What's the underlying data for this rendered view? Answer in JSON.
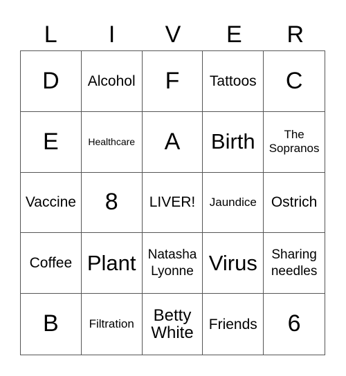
{
  "header": [
    "L",
    "I",
    "V",
    "E",
    "R"
  ],
  "cells": [
    {
      "text": "D",
      "size": "s-xl"
    },
    {
      "text": "Alcohol",
      "size": "s-m"
    },
    {
      "text": "F",
      "size": "s-xl"
    },
    {
      "text": "Tattoos",
      "size": "s-m"
    },
    {
      "text": "C",
      "size": "s-xl"
    },
    {
      "text": "E",
      "size": "s-xl"
    },
    {
      "text": "Healthcare",
      "size": "s-xxs"
    },
    {
      "text": "A",
      "size": "s-xl"
    },
    {
      "text": "Birth",
      "size": "s-l"
    },
    {
      "text": "The Sopranos",
      "size": "s-xs"
    },
    {
      "text": "Vaccine",
      "size": "s-m"
    },
    {
      "text": "8",
      "size": "s-xl"
    },
    {
      "text": "LIVER!",
      "size": "s-m"
    },
    {
      "text": "Jaundice",
      "size": "s-xs"
    },
    {
      "text": "Ostrich",
      "size": "s-m"
    },
    {
      "text": "Coffee",
      "size": "s-m"
    },
    {
      "text": "Plant",
      "size": "s-l"
    },
    {
      "text": "Natasha Lyonne",
      "size": "s-s"
    },
    {
      "text": "Virus",
      "size": "s-l"
    },
    {
      "text": "Sharing needles",
      "size": "s-s"
    },
    {
      "text": "B",
      "size": "s-xl"
    },
    {
      "text": "Filtration",
      "size": "s-xs"
    },
    {
      "text": "Betty White",
      "size": "s-m2"
    },
    {
      "text": "Friends",
      "size": "s-m"
    },
    {
      "text": "6",
      "size": "s-xl"
    }
  ]
}
